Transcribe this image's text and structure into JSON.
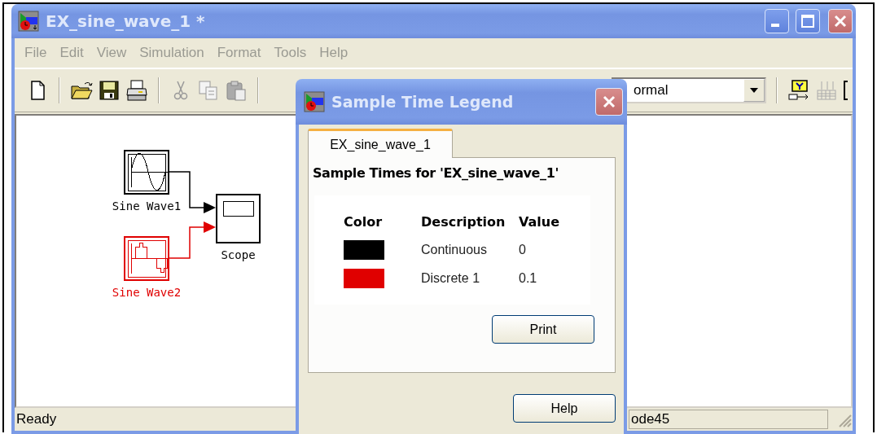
{
  "window": {
    "title": "EX_sine_wave_1 *"
  },
  "menu": [
    "File",
    "Edit",
    "View",
    "Simulation",
    "Format",
    "Tools",
    "Help"
  ],
  "toolbar": {
    "solver_dropdown": {
      "value": "ormal"
    }
  },
  "diagram": {
    "blocks": [
      {
        "kind": "sine",
        "label": "Sine Wave1",
        "color": "#000000"
      },
      {
        "kind": "discrete",
        "label": "Sine Wave2",
        "color": "#e00000"
      },
      {
        "kind": "scope",
        "label": "Scope",
        "color": "#000000"
      }
    ],
    "signals": [
      {
        "color": "#000000"
      },
      {
        "color": "#e00000"
      }
    ]
  },
  "status_bar": [
    "Ready",
    "ode45"
  ],
  "dialog": {
    "title": "Sample Time Legend",
    "tabs": [
      {
        "label": "EX_sine_wave_1",
        "selected": true
      }
    ],
    "heading": "Sample Times for 'EX_sine_wave_1'",
    "columns": [
      "Color",
      "Description",
      "Value"
    ],
    "rows": [
      {
        "color": "#000000",
        "description": "Continuous",
        "value": "0"
      },
      {
        "color": "#e00000",
        "description": "Discrete 1",
        "value": "0.1"
      }
    ],
    "buttons": [
      "Print",
      "Help"
    ]
  }
}
